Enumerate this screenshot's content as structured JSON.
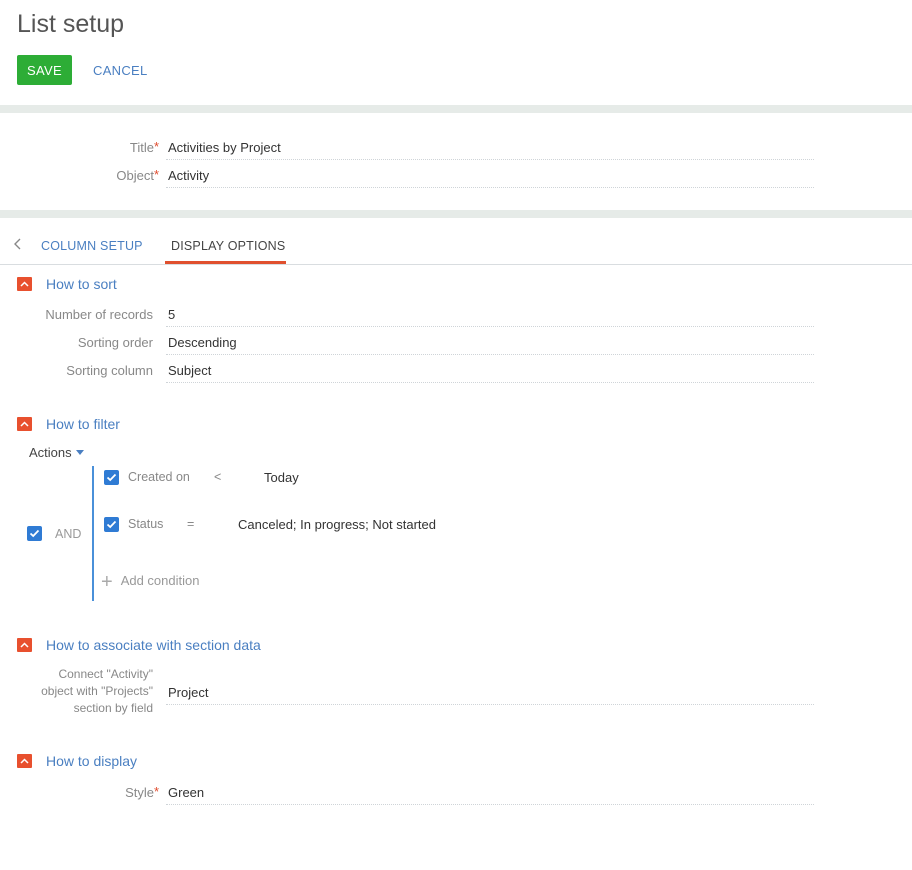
{
  "header": {
    "title": "List setup",
    "save_label": "SAVE",
    "cancel_label": "CANCEL"
  },
  "general": {
    "title_label": "Title",
    "title_value": "Activities by Project",
    "object_label": "Object",
    "object_value": "Activity",
    "required_mark": "*"
  },
  "tabs": [
    {
      "label": "COLUMN SETUP",
      "active": false
    },
    {
      "label": "DISPLAY OPTIONS",
      "active": true
    }
  ],
  "sort": {
    "title": "How to sort",
    "fields": [
      {
        "label": "Number of records",
        "value": "5"
      },
      {
        "label": "Sorting order",
        "value": "Descending"
      },
      {
        "label": "Sorting column",
        "value": "Subject"
      }
    ]
  },
  "filter": {
    "title": "How to filter",
    "actions_label": "Actions",
    "group_operator": "AND",
    "conditions": [
      {
        "column": "Created on",
        "operator": "<",
        "value": "Today",
        "checked": true
      },
      {
        "column": "Status",
        "operator": "=",
        "value": "Canceled; In progress; Not started",
        "checked": true
      }
    ],
    "add_condition_label": "Add condition"
  },
  "associate": {
    "title": "How to associate with section data",
    "label_lines": [
      "Connect \"Activity\"",
      "object with \"Projects\"",
      "section by field"
    ],
    "value": "Project"
  },
  "display": {
    "title": "How to display",
    "style_label": "Style",
    "style_value": "Green"
  },
  "colors": {
    "accent_blue": "#4a7fc1",
    "save_green": "#2dad36",
    "toggle_orange": "#e8502e",
    "checkbox_blue": "#2f7bd4"
  }
}
